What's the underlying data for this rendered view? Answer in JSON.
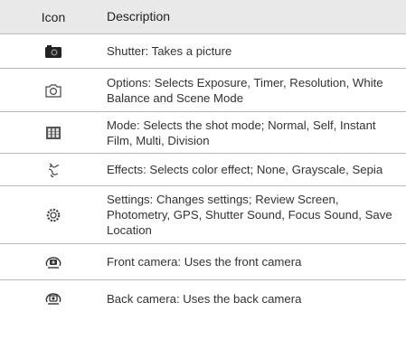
{
  "header": {
    "icon_col": "Icon",
    "desc_col": "Description"
  },
  "rows": [
    {
      "icon": "shutter-icon",
      "text": "Shutter: Takes a picture"
    },
    {
      "icon": "options-camera-icon",
      "text": "Options: Selects Exposure, Timer, Resolution, White Balance and Scene Mode"
    },
    {
      "icon": "mode-grid-icon",
      "text": "Mode: Selects the shot mode; Normal, Self, Instant Film, Multi, Division"
    },
    {
      "icon": "effects-icon",
      "text": "Effects: Selects color effect; None, Grayscale, Sepia"
    },
    {
      "icon": "settings-gear-icon",
      "text": "Settings: Changes settings; Review Screen, Photometry, GPS, Shutter Sound, Focus Sound, Save Location"
    },
    {
      "icon": "front-camera-icon",
      "text": "Front camera: Uses the front camera"
    },
    {
      "icon": "back-camera-icon",
      "text": "Back camera: Uses the back camera"
    }
  ]
}
